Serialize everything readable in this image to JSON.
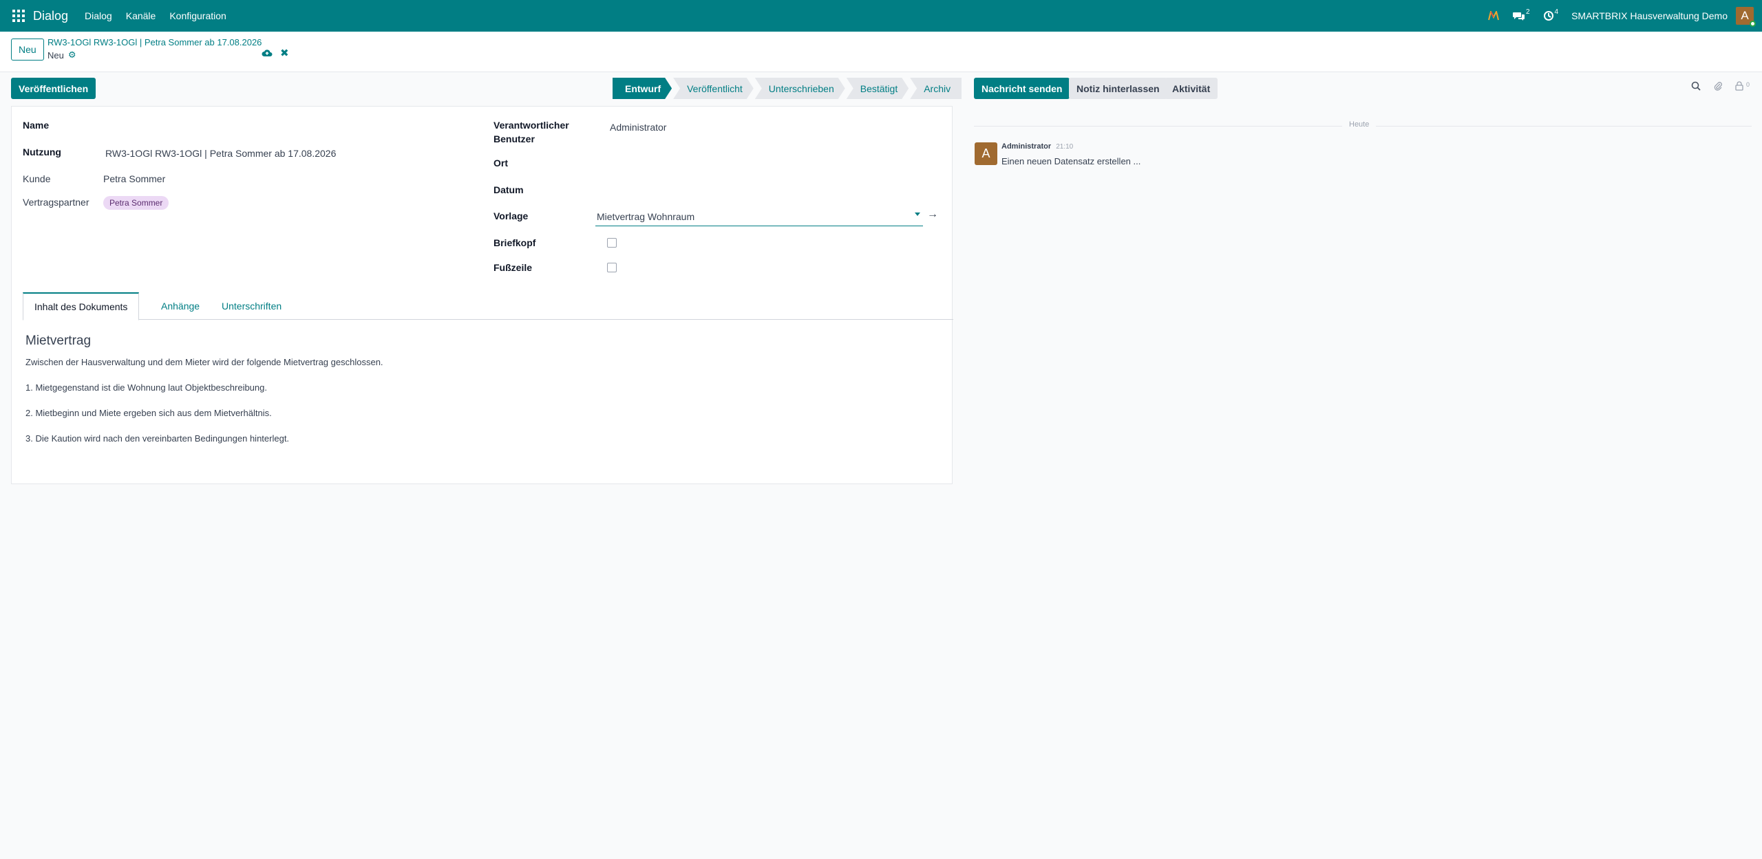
{
  "navbar": {
    "brand": "Dialog",
    "menus": [
      "Dialog",
      "Kanäle",
      "Konfiguration"
    ],
    "messages_count": "2",
    "activities_count": "4",
    "company": "SMARTBRIX Hausverwaltung Demo",
    "avatar_letter": "A"
  },
  "control_panel": {
    "new_label": "Neu",
    "breadcrumb_parent": "RW3-1OGl RW3-1OGl | Petra Sommer ab 17.08.2026",
    "breadcrumb_current": "Neu"
  },
  "actions": {
    "publish_label": "Veröffentlichen"
  },
  "statusbar": {
    "stages": [
      "Entwurf",
      "Veröffentlicht",
      "Unterschrieben",
      "Bestätigt",
      "Archiv"
    ],
    "active_index": 0
  },
  "form": {
    "name_label": "Name",
    "usage_label": "Nutzung",
    "usage_value": "RW3-1OGl RW3-1OGl | Petra Sommer ab 17.08.2026",
    "customer_label": "Kunde",
    "customer_value": "Petra Sommer",
    "partner_label": "Vertragspartner",
    "partner_tag": "Petra Sommer",
    "responsible_label_1": "Verantwortlicher",
    "responsible_label_2": "Benutzer",
    "responsible_value": "Administrator",
    "location_label": "Ort",
    "date_label": "Datum",
    "template_label": "Vorlage",
    "template_value": "Mietvertrag Wohnraum",
    "letterhead_label": "Briefkopf",
    "footer_label": "Fußzeile"
  },
  "tabs": [
    "Inhalt des Dokuments",
    "Anhänge",
    "Unterschriften"
  ],
  "document": {
    "title": "Mietvertrag",
    "lines": [
      "Zwischen der Hausverwaltung und dem Mieter wird der folgende Mietvertrag geschlossen.",
      "1. Mietgegenstand ist die Wohnung laut Objektbeschreibung.",
      "2. Mietbeginn und Miete ergeben sich aus dem Mietverhältnis.",
      "3. Die Kaution wird nach den vereinbarten Bedingungen hinterlegt."
    ]
  },
  "chatter": {
    "send_message": "Nachricht senden",
    "log_note": "Notiz hinterlassen",
    "activity": "Aktivität",
    "followers_count": "0",
    "today_label": "Heute",
    "message": {
      "avatar_letter": "A",
      "author": "Administrator",
      "time": "21:10",
      "body": "Einen neuen Datensatz erstellen ..."
    }
  }
}
